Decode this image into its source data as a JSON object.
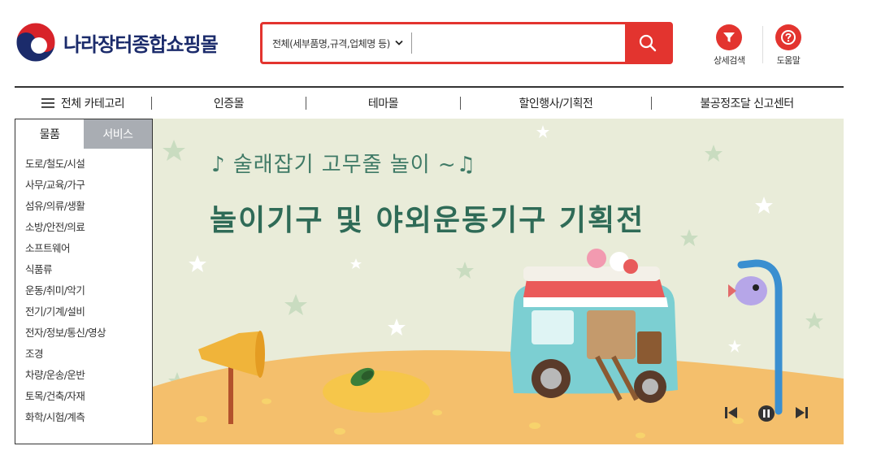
{
  "header": {
    "logo_text": "나라장터종합쇼핑몰",
    "search": {
      "scope_label": "전체(세부품명,규격,업체명 등)",
      "value": "",
      "placeholder": ""
    },
    "utilities": [
      {
        "label": "상세검색",
        "icon": "filter-icon"
      },
      {
        "label": "도움말",
        "icon": "help-icon"
      }
    ]
  },
  "nav": {
    "all_categories": "전체 카테고리",
    "items": [
      "인증몰",
      "테마몰",
      "할인행사/기획전",
      "불공정조달 신고센터"
    ]
  },
  "sidebar": {
    "tabs": [
      {
        "label": "물품",
        "active": true
      },
      {
        "label": "서비스",
        "active": false
      }
    ],
    "categories": [
      "도로/철도/시설",
      "사무/교육/가구",
      "섬유/의류/생활",
      "소방/안전/의료",
      "소프트웨어",
      "식품류",
      "운동/취미/악기",
      "전기/기계/설비",
      "전자/정보/통신/영상",
      "조경",
      "차량/운송/운반",
      "토목/건축/자재",
      "화학/시험/계측"
    ]
  },
  "banner": {
    "subtitle": "♪ 술래잡기 고무줄 놀이 ~♫",
    "title": "놀이기구 및 야외운동기구 기획전",
    "controls": [
      "prev-icon",
      "pause-icon",
      "next-icon"
    ]
  },
  "colors": {
    "accent": "#e3342f",
    "brand_navy": "#1b2b6b",
    "banner_bg": "#e9ecd9",
    "banner_ground": "#f4bf6c",
    "banner_text": "#2f6b57",
    "tab_inactive": "#a9adb3"
  }
}
